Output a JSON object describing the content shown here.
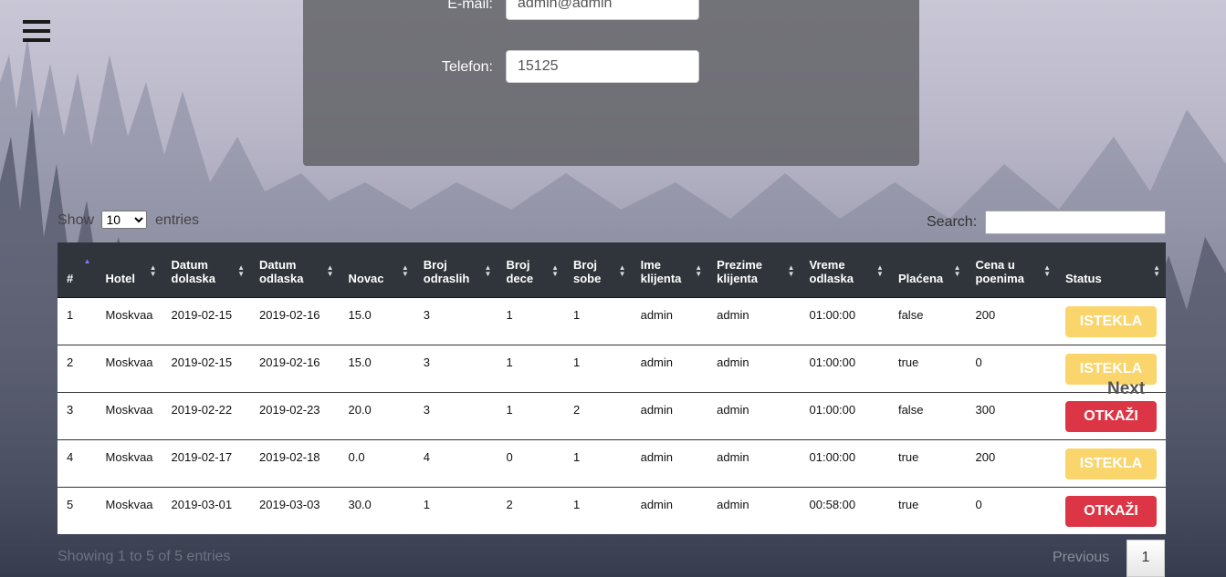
{
  "form": {
    "email_label": "E-mail:",
    "email_value": "admin@admin",
    "phone_label": "Telefon:",
    "phone_value": "15125"
  },
  "datatable": {
    "show_label": "Show",
    "entries_label": "entries",
    "page_length": "10",
    "search_label": "Search:",
    "info": "Showing 1 to 5 of 5 entries",
    "previous": "Previous",
    "next": "Next",
    "current_page": "1"
  },
  "columns": [
    "#",
    "Hotel",
    "Datum dolaska",
    "Datum odlaska",
    "Novac",
    "Broj odraslih",
    "Broj dece",
    "Broj sobe",
    "Ime klijenta",
    "Prezime klijenta",
    "Vreme odlaska",
    "Plaćena",
    "Cena u poenima",
    "Status"
  ],
  "rows": [
    {
      "id": "1",
      "hotel": "Moskvaa",
      "arrival": "2019-02-15",
      "departure": "2019-02-16",
      "money": "15.0",
      "adults": "3",
      "kids": "1",
      "room": "1",
      "first": "admin",
      "last": "admin",
      "time": "01:00:00",
      "paid": "false",
      "points": "200",
      "status": "ISTEKLA",
      "status_type": "expired"
    },
    {
      "id": "2",
      "hotel": "Moskvaa",
      "arrival": "2019-02-15",
      "departure": "2019-02-16",
      "money": "15.0",
      "adults": "3",
      "kids": "1",
      "room": "1",
      "first": "admin",
      "last": "admin",
      "time": "01:00:00",
      "paid": "true",
      "points": "0",
      "status": "ISTEKLA",
      "status_type": "expired"
    },
    {
      "id": "3",
      "hotel": "Moskvaa",
      "arrival": "2019-02-22",
      "departure": "2019-02-23",
      "money": "20.0",
      "adults": "3",
      "kids": "1",
      "room": "2",
      "first": "admin",
      "last": "admin",
      "time": "01:00:00",
      "paid": "false",
      "points": "300",
      "status": "OTKAŽI",
      "status_type": "cancel"
    },
    {
      "id": "4",
      "hotel": "Moskvaa",
      "arrival": "2019-02-17",
      "departure": "2019-02-18",
      "money": "0.0",
      "adults": "4",
      "kids": "0",
      "room": "1",
      "first": "admin",
      "last": "admin",
      "time": "01:00:00",
      "paid": "true",
      "points": "200",
      "status": "ISTEKLA",
      "status_type": "expired"
    },
    {
      "id": "5",
      "hotel": "Moskvaa",
      "arrival": "2019-03-01",
      "departure": "2019-03-03",
      "money": "30.0",
      "adults": "1",
      "kids": "2",
      "room": "1",
      "first": "admin",
      "last": "admin",
      "time": "00:58:00",
      "paid": "true",
      "points": "0",
      "status": "OTKAŽI",
      "status_type": "cancel"
    }
  ],
  "colors": {
    "expired": "#f9d56b",
    "cancel": "#dc3545",
    "header": "#2f353a"
  },
  "icons": {
    "menu": "hamburger-icon",
    "sort": "sort-arrows-icon"
  }
}
